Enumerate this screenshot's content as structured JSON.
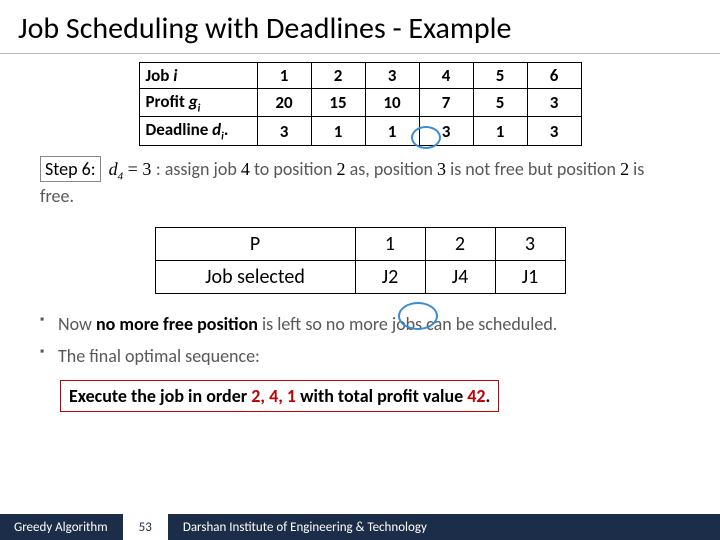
{
  "title": "Job Scheduling with Deadlines - Example",
  "table": {
    "rows": [
      {
        "label_pre": "Job ",
        "label_var": "i",
        "cells": [
          "1",
          "2",
          "3",
          "4",
          "5",
          "6"
        ]
      },
      {
        "label_pre": "Profit ",
        "label_var": "g",
        "label_sub": "i",
        "cells": [
          "20",
          "15",
          "10",
          "7",
          "5",
          "3"
        ]
      },
      {
        "label_pre": "Deadline ",
        "label_var": "d",
        "label_sub": "i",
        "label_post": ".",
        "cells": [
          "3",
          "1",
          "1",
          "3",
          "1",
          "3"
        ]
      }
    ]
  },
  "step": {
    "box": "Step 6:",
    "math_var": "d",
    "math_sub": "4",
    "math_eq": " = 3 ",
    "text1": ": assign job ",
    "v1": "4",
    "text2": " to position ",
    "v2": "2",
    "text3": " as, position ",
    "v3": "3",
    "text4": " is not free but position ",
    "v4": "2",
    "text5": " is free."
  },
  "sel": {
    "rows": [
      {
        "label": "P",
        "cells": [
          "1",
          "2",
          "3"
        ]
      },
      {
        "label": "Job selected",
        "cells": [
          "J2",
          "J4",
          "J1"
        ]
      }
    ]
  },
  "bullets": {
    "b1_a": "Now ",
    "b1_bold": "no more free position",
    "b1_b": " is left so no more jobs can be scheduled.",
    "b2": "The final optimal sequence:"
  },
  "final": {
    "a": "Execute the job in order ",
    "order": "2, 4, 1",
    "b": " with total profit value ",
    "val": "42",
    "c": "."
  },
  "footer": {
    "section": "Greedy Algorithm",
    "page": "53",
    "inst": "Darshan Institute of Engineering & Technology"
  },
  "chart_data": {
    "type": "table",
    "title": "Job Scheduling with Deadlines",
    "jobs": {
      "headers": [
        "Job i",
        "Profit g_i",
        "Deadline d_i"
      ],
      "columns": [
        "1",
        "2",
        "3",
        "4",
        "5",
        "6"
      ],
      "profit": [
        20,
        15,
        10,
        7,
        5,
        3
      ],
      "deadline": [
        3,
        1,
        1,
        3,
        1,
        3
      ]
    },
    "selection": {
      "P": [
        1,
        2,
        3
      ],
      "Job selected": [
        "J2",
        "J4",
        "J1"
      ]
    },
    "optimal_order": [
      2,
      4,
      1
    ],
    "total_profit": 42
  }
}
